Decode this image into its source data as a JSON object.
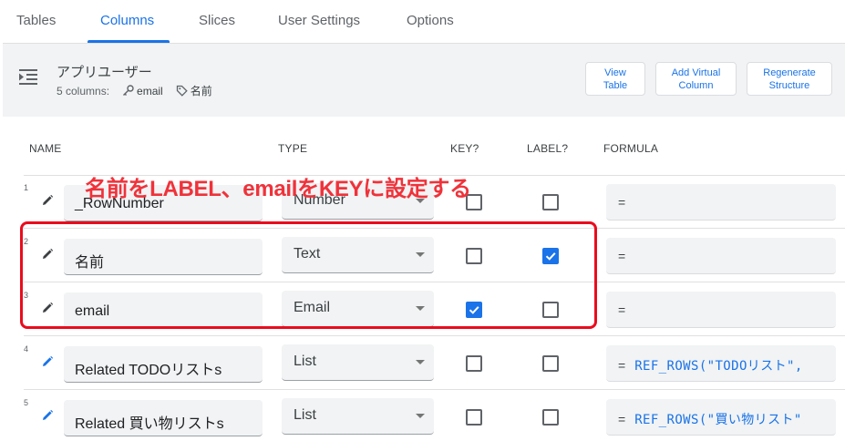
{
  "tabs": [
    {
      "label": "Tables",
      "active": false
    },
    {
      "label": "Columns",
      "active": true
    },
    {
      "label": "Slices",
      "active": false
    },
    {
      "label": "User Settings",
      "active": false
    },
    {
      "label": "Options",
      "active": false
    }
  ],
  "header": {
    "title": "アプリユーザー",
    "columns_count": "5 columns:",
    "key_column": "email",
    "label_column": "名前",
    "buttons": {
      "view_table": [
        "View",
        "Table"
      ],
      "add_virtual_column": [
        "Add Virtual",
        "Column"
      ],
      "regenerate_structure": [
        "Regenerate",
        "Structure"
      ]
    }
  },
  "column_headers": {
    "name": "NAME",
    "type": "TYPE",
    "key": "KEY?",
    "label": "LABEL?",
    "formula": "FORMULA"
  },
  "rows": [
    {
      "num": "1",
      "name": "_RowNumber",
      "type": "Number",
      "key": false,
      "label": false,
      "formula_eq": "=",
      "formula_expr": "",
      "virtual": false
    },
    {
      "num": "2",
      "name": "名前",
      "type": "Text",
      "key": false,
      "label": true,
      "formula_eq": "=",
      "formula_expr": "",
      "virtual": false
    },
    {
      "num": "3",
      "name": "email",
      "type": "Email",
      "key": true,
      "label": false,
      "formula_eq": "=",
      "formula_expr": "",
      "virtual": false
    },
    {
      "num": "4",
      "name": "Related TODOリストs",
      "type": "List",
      "key": false,
      "label": false,
      "formula_eq": "=",
      "formula_expr": "REF_ROWS(\"TODOリスト\",",
      "virtual": true
    },
    {
      "num": "5",
      "name": "Related 買い物リストs",
      "type": "List",
      "key": false,
      "label": false,
      "formula_eq": "=",
      "formula_expr": "REF_ROWS(\"買い物リスト\"",
      "virtual": true
    }
  ],
  "annotation": {
    "text": "名前をLABEL、emailをKEYに設定する",
    "color": "#ea0c1d"
  },
  "colors": {
    "accent": "#1a73e8",
    "panel_bg": "#f1f3f4",
    "field_bg": "#f1f3f4"
  }
}
